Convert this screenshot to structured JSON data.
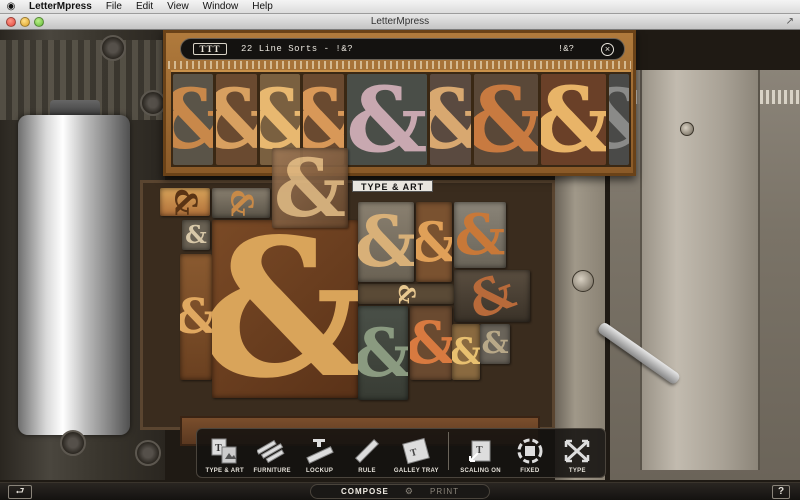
{
  "menubar": {
    "apple_icon": "apple-icon",
    "items": [
      "LetterMpress",
      "File",
      "Edit",
      "View",
      "Window",
      "Help"
    ]
  },
  "window": {
    "title": "LetterMpress"
  },
  "drawer": {
    "icon_label": "TTT",
    "title": "22 Line  Sorts - !&?",
    "chars": "!&?",
    "close_icon": "×"
  },
  "tooltip": {
    "label": "TYPE & ART"
  },
  "toolbar": {
    "items": [
      {
        "label": "TYPE & ART",
        "icon": "type-art-icon"
      },
      {
        "label": "FURNITURE",
        "icon": "furniture-icon"
      },
      {
        "label": "LOCKUP",
        "icon": "lockup-icon"
      },
      {
        "label": "RULE",
        "icon": "rule-icon"
      },
      {
        "label": "GALLEY TRAY",
        "icon": "galley-tray-icon"
      },
      {
        "label": "SCALING ON",
        "icon": "scaling-icon"
      },
      {
        "label": "FIXED",
        "icon": "fixed-icon"
      },
      {
        "label": "TYPE",
        "icon": "type-icon"
      }
    ]
  },
  "bottombar": {
    "back_icon": "⮐",
    "compose": "COMPOSE",
    "print": "PRINT",
    "help": "?"
  },
  "colors": {
    "wood_light": "#d9a45a",
    "wood_mid": "#b0703a",
    "wood_dark": "#7a4a26",
    "wood_gray": "#8a8070"
  }
}
